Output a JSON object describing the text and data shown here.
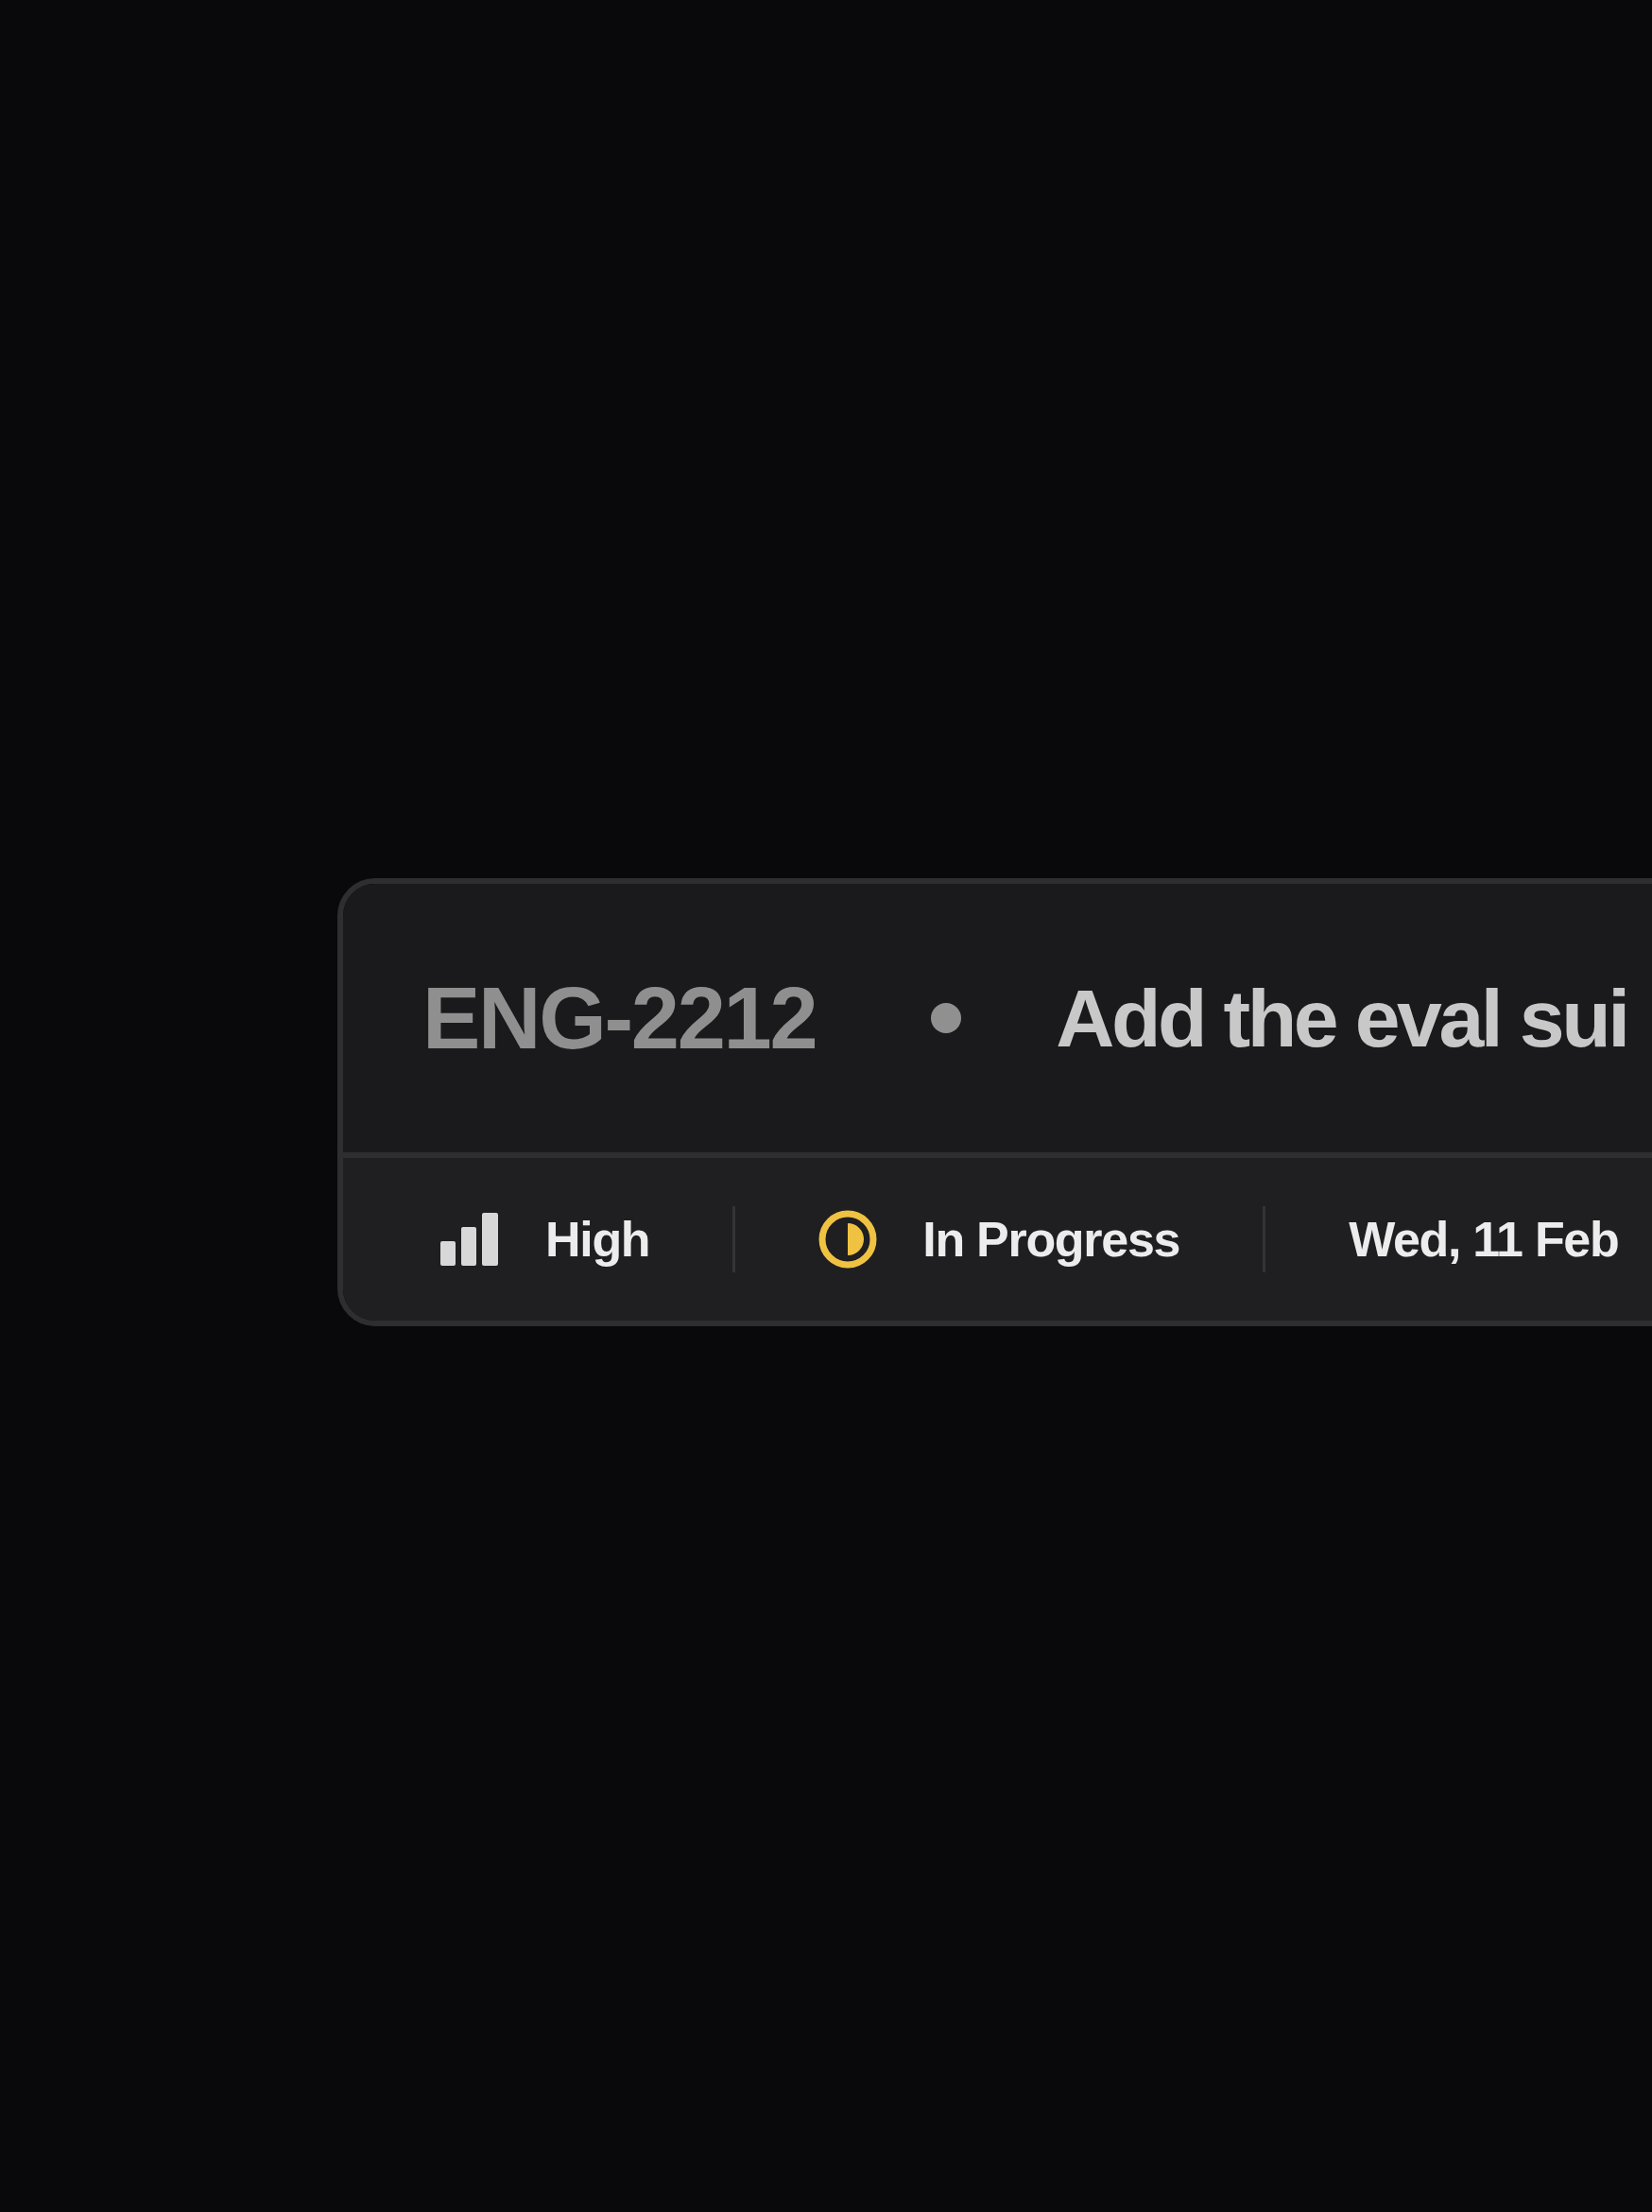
{
  "issue": {
    "id": "ENG-2212",
    "title": "Add the eval sui"
  },
  "properties": [
    {
      "kind": "priority",
      "label": "High"
    },
    {
      "kind": "status",
      "label": "In Progress",
      "color": "#f0c242"
    },
    {
      "kind": "date",
      "label": "Wed, 11 Feb"
    }
  ]
}
